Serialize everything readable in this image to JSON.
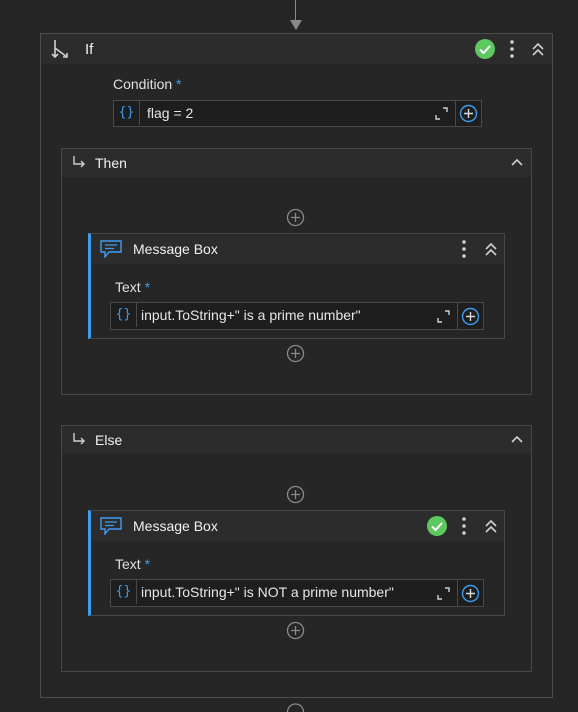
{
  "if_activity": {
    "title": "If",
    "condition_label": "Condition",
    "required_marker": "*",
    "condition_value": "flag = 2",
    "status": "valid"
  },
  "then_branch": {
    "title": "Then",
    "message_box": {
      "title": "Message Box",
      "text_label": "Text",
      "required_marker": "*",
      "text_value": "input.ToString+\" is a prime number\""
    }
  },
  "else_branch": {
    "title": "Else",
    "message_box": {
      "title": "Message Box",
      "text_label": "Text",
      "required_marker": "*",
      "text_value": "input.ToString+\" is NOT a prime number\"",
      "status": "valid"
    }
  },
  "icons": {
    "if": "if-branch-icon",
    "valid": "check-circle-icon",
    "menu": "vertical-dots-icon",
    "collapse": "double-chevron-up-icon",
    "branch": "branch-arrow-icon",
    "chevron": "chevron-up-icon",
    "expression": "curly-braces-icon",
    "expand": "expand-editor-icon",
    "add": "plus-circle-icon",
    "message": "message-bubble-icon"
  },
  "colors": {
    "background": "#252526",
    "panel": "#2c2c2c",
    "border": "#474747",
    "accent": "#3d9cf0",
    "success": "#5cc85f"
  }
}
